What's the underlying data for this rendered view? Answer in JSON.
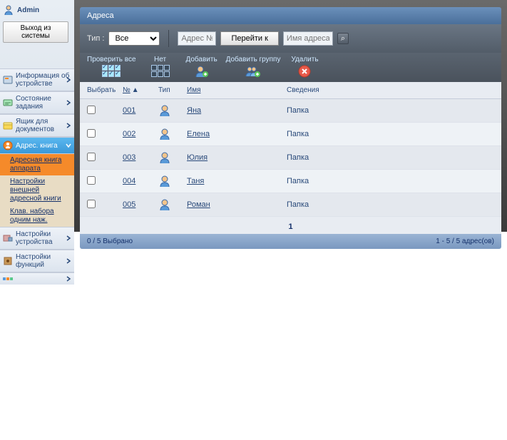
{
  "sidebar": {
    "user_label": "Admin",
    "logout_label": "Выход из системы",
    "items": [
      {
        "label": "Информация об устройстве"
      },
      {
        "label": "Состояние задания"
      },
      {
        "label": "Ящик для документов"
      },
      {
        "label": "Адрес. книга"
      },
      {
        "label": "Настройки устройства"
      },
      {
        "label": "Настройки функций"
      }
    ],
    "sub_items": [
      {
        "label": "Адресная книга аппарата"
      },
      {
        "label": "Настройки внешней адресной книги"
      },
      {
        "label": "Клав. набора одним наж."
      }
    ]
  },
  "main": {
    "title": "Адреса",
    "filter": {
      "type_label": "Тип :",
      "type_value": "Все",
      "addr_placeholder": "Адрес №",
      "go_label": "Перейти к",
      "name_placeholder": "Имя адреса"
    },
    "toolbar": {
      "check_all": "Проверить все",
      "none": "Нет",
      "add": "Добавить",
      "add_group": "Добавить группу",
      "delete": "Удалить"
    },
    "columns": {
      "select": "Выбрать",
      "num": "№",
      "type": "Тип",
      "name": "Имя",
      "info": "Сведения"
    },
    "rows": [
      {
        "num": "001",
        "name": "Яна",
        "info": "Папка"
      },
      {
        "num": "002",
        "name": "Елена",
        "info": "Папка"
      },
      {
        "num": "003",
        "name": "Юлия",
        "info": "Папка"
      },
      {
        "num": "004",
        "name": "Таня",
        "info": "Папка"
      },
      {
        "num": "005",
        "name": "Роман",
        "info": "Папка"
      }
    ],
    "page": "1",
    "status_left": "0 / 5 Выбрано",
    "status_right": "1 - 5 / 5 адрес(ов)"
  }
}
